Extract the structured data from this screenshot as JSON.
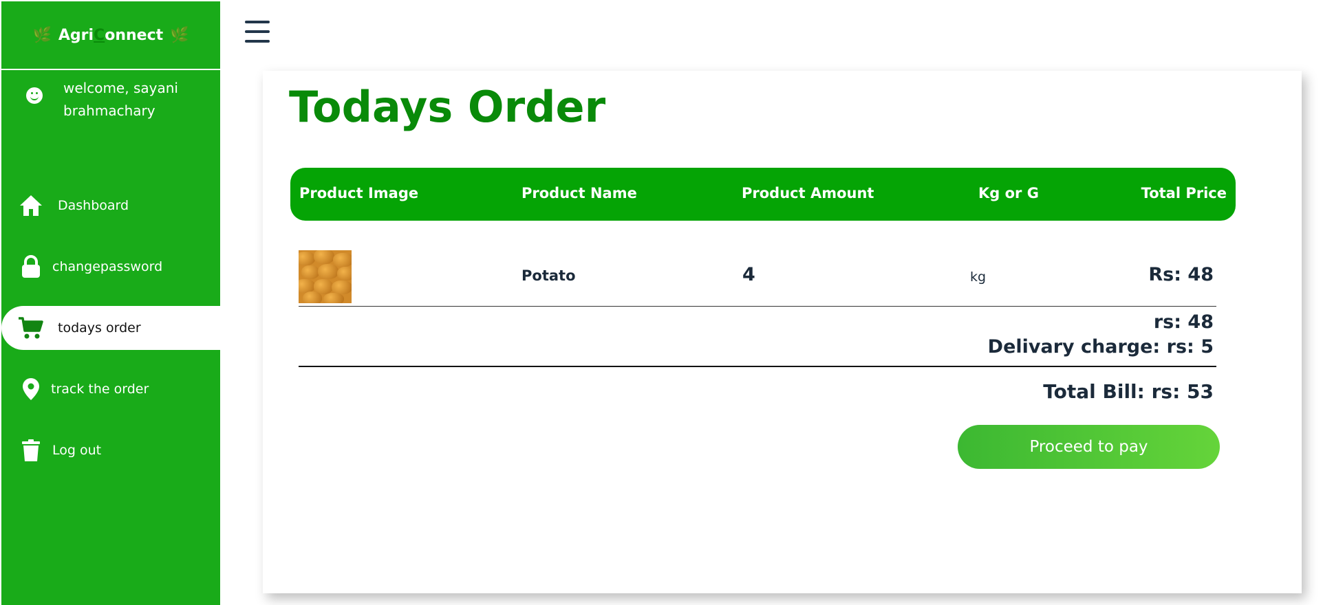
{
  "brand": {
    "prefix": "Agri",
    "c": "C",
    "suffix": "onnect",
    "leaf_left": "🌿",
    "leaf_right": "🌿"
  },
  "user": {
    "welcome": "welcome, sayani brahmachary"
  },
  "sidebar": {
    "items": [
      {
        "label": "Dashboard",
        "icon": "home-icon"
      },
      {
        "label": "changepassword",
        "icon": "lock-icon"
      },
      {
        "label": "todays order",
        "icon": "cart-icon",
        "active": true
      },
      {
        "label": "track the order",
        "icon": "location-pin-icon"
      },
      {
        "label": "Log out",
        "icon": "trash-icon"
      }
    ]
  },
  "page": {
    "title": "Todays Order"
  },
  "table": {
    "headers": [
      "Product Image",
      "Product Name",
      "Product Amount",
      "Kg or G",
      "Total Price"
    ],
    "rows": [
      {
        "name": "Potato",
        "amount": "4",
        "unit": "kg",
        "price": "Rs: 48"
      }
    ]
  },
  "summary": {
    "subtotal": "rs: 48",
    "delivery": "Delivary charge: rs: 5",
    "total": "Total Bill: rs: 53"
  },
  "actions": {
    "pay_label": "Proceed to pay"
  },
  "colors": {
    "sidebar": "#19ab19",
    "header": "#05a405",
    "title": "#098a09",
    "button_start": "#3cb832",
    "button_end": "#65d43a"
  }
}
